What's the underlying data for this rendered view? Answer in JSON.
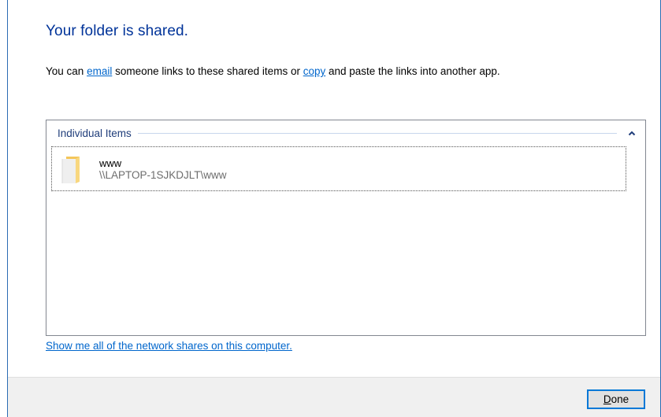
{
  "dialog": {
    "heading": "Your folder is shared.",
    "intro": {
      "prefix": "You can ",
      "email_link": "email",
      "middle": " someone links to these shared items or ",
      "copy_link": "copy",
      "suffix": " and paste the links into another app."
    }
  },
  "items_group": {
    "title": "Individual Items",
    "collapse_icon": "chevron-up-icon",
    "items": [
      {
        "name": "www",
        "path": "\\\\LAPTOP-1SJKDJLT\\www",
        "icon": "folder-icon"
      }
    ]
  },
  "network_shares_link": "Show me all of the network shares on this computer.",
  "footer": {
    "done_accel": "D",
    "done_rest": "one"
  },
  "colors": {
    "heading": "#003399",
    "link": "#0066cc",
    "footer_bg": "#f0f0f0",
    "button_border": "#0078d7"
  }
}
